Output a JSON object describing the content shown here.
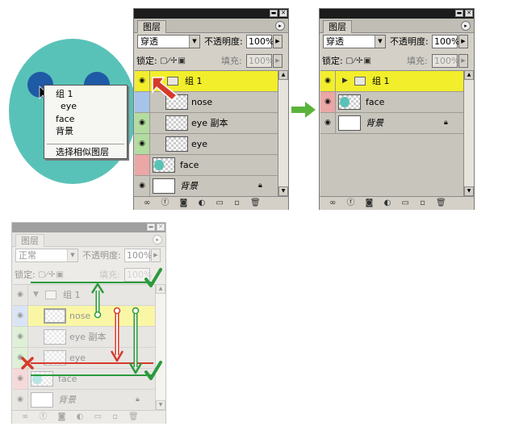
{
  "colors": {
    "panel_bg": "#d4d0c8",
    "selected_layer": "#f2ee2c",
    "eye_blue": "#a6c3ea",
    "eye_green": "#b2dca0",
    "eye_red": "#eba6a6",
    "face_teal": "#59c2b8",
    "eye_navy": "#1f5aa6",
    "arrow_green": "#5ab43c",
    "check_green": "#2a9a3c",
    "arrow_red": "#d63a2c"
  },
  "context_menu": {
    "items": [
      "组 1",
      "eye",
      "face",
      "背景"
    ],
    "action": "选择相似图层"
  },
  "panel1": {
    "tab": "图层",
    "blend_mode": "穿透",
    "opacity_label": "不透明度:",
    "opacity_value": "100%",
    "lock_label": "锁定:",
    "fill_label": "填充:",
    "fill_value": "100%",
    "layers": {
      "group": "组 1",
      "nose": "nose",
      "eye_copy": "eye 副本",
      "eye": "eye",
      "face": "face",
      "background": "背景"
    }
  },
  "panel2": {
    "tab": "图层",
    "blend_mode": "穿透",
    "opacity_label": "不透明度:",
    "opacity_value": "100%",
    "lock_label": "锁定:",
    "fill_label": "填充:",
    "fill_value": "100%",
    "layers": {
      "group": "组 1",
      "face": "face",
      "background": "背景"
    }
  },
  "panel3": {
    "tab": "图层",
    "blend_mode": "正常",
    "opacity_label": "不透明度:",
    "opacity_value": "100%",
    "lock_label": "锁定:",
    "fill_label": "填充:",
    "fill_value": "100%",
    "layers": {
      "group": "组 1",
      "nose": "nose",
      "eye_copy": "eye 副本",
      "eye": "eye",
      "face": "face",
      "background": "背景"
    }
  },
  "icons": {
    "visibility": "eye-icon",
    "lock": "lock-icon",
    "folder": "folder-icon",
    "expand": "triangle-down-icon",
    "collapsed": "triangle-right-icon",
    "cursor": "mouse-cursor-icon",
    "check": "checkmark-icon",
    "cross": "x-mark-icon"
  }
}
